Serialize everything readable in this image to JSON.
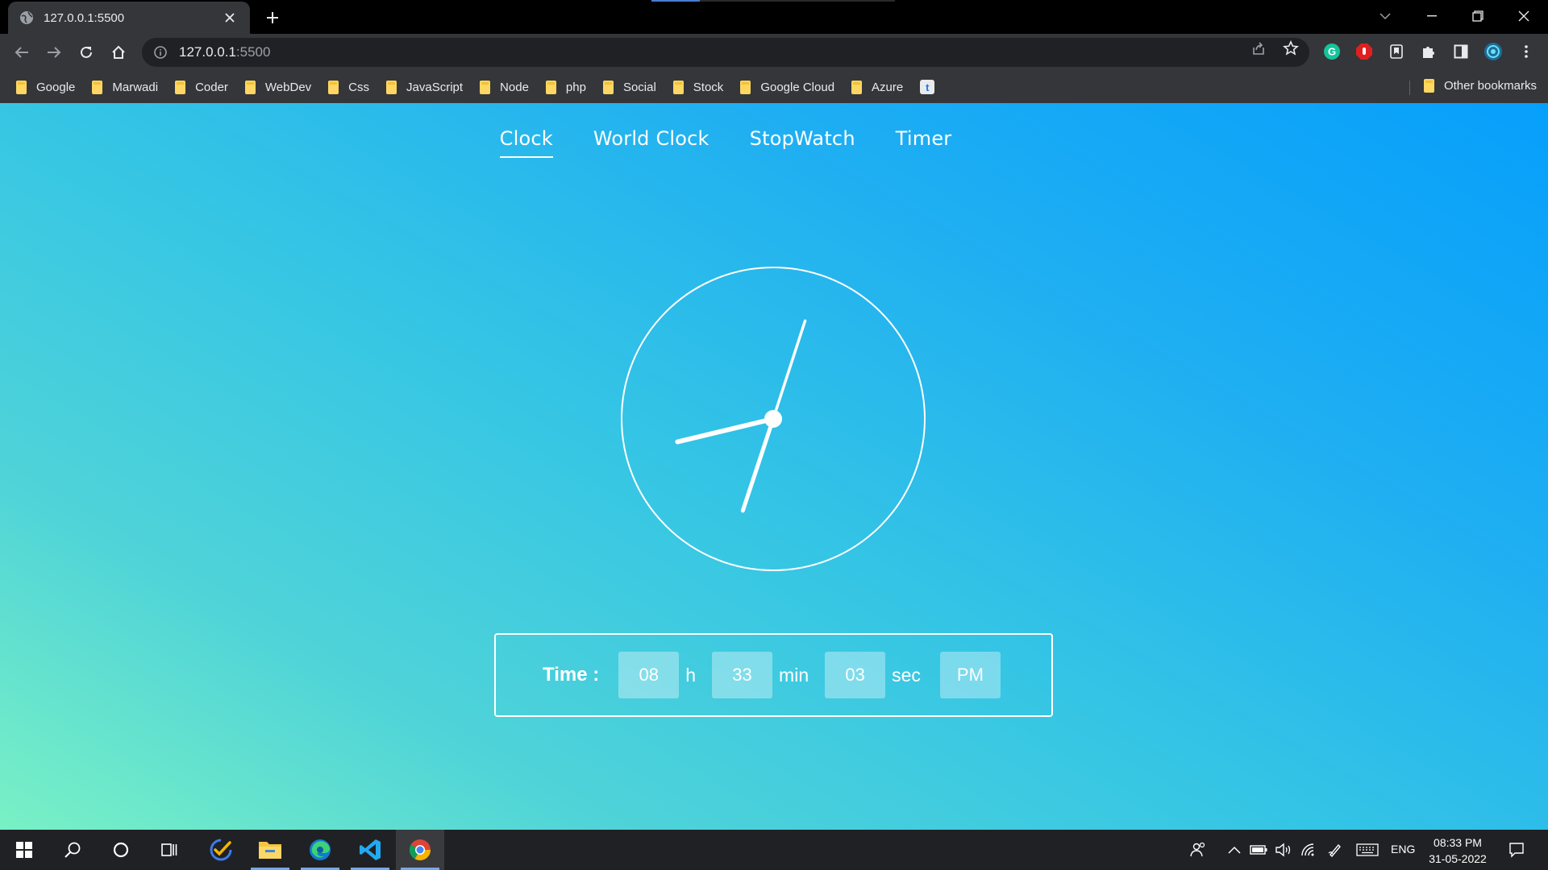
{
  "browser": {
    "tab_title": "127.0.0.1:5500",
    "url_host": "127.0.0.1",
    "url_port": ":5500",
    "bookmarks": [
      "Google",
      "Marwadi",
      "Coder",
      "WebDev",
      "Css",
      "JavaScript",
      "Node",
      "php",
      "Social",
      "Stock",
      "Google Cloud",
      "Azure"
    ],
    "bookmark_icon_letter": "t",
    "other_bookmarks": "Other bookmarks"
  },
  "nav": {
    "items": [
      "Clock",
      "World Clock",
      "StopWatch",
      "Timer"
    ],
    "active": "Clock"
  },
  "clock_face": {
    "hour": 8,
    "minute": 33,
    "second": 3
  },
  "time_display": {
    "label": "Time :",
    "hours": "08",
    "hours_unit": "h",
    "minutes": "33",
    "minutes_unit": "min",
    "seconds": "03",
    "seconds_unit": "sec",
    "ampm": "PM"
  },
  "taskbar": {
    "language": "ENG",
    "time": "08:33 PM",
    "date": "31-05-2022"
  },
  "colors": {
    "gradient_start": "#79f1c5",
    "gradient_end": "#069ffb",
    "chrome_dark": "#35363a"
  },
  "icons": [
    "globe-icon",
    "close-icon",
    "plus-icon",
    "back-icon",
    "forward-icon",
    "reload-icon",
    "home-icon",
    "info-icon",
    "share-icon",
    "star-icon",
    "grammarly-icon",
    "adblock-icon",
    "bookmark-ext-icon",
    "puzzle-icon",
    "sidepanel-icon",
    "profile-icon",
    "kebab-menu-icon",
    "windows-start-icon",
    "search-icon",
    "cortana-icon",
    "task-view-icon",
    "todo-icon",
    "file-explorer-icon",
    "edge-icon",
    "vscode-icon",
    "chrome-icon",
    "people-icon",
    "chevron-up-icon",
    "battery-icon",
    "volume-icon",
    "wifi-icon",
    "pen-icon",
    "keyboard-icon",
    "notification-icon"
  ]
}
